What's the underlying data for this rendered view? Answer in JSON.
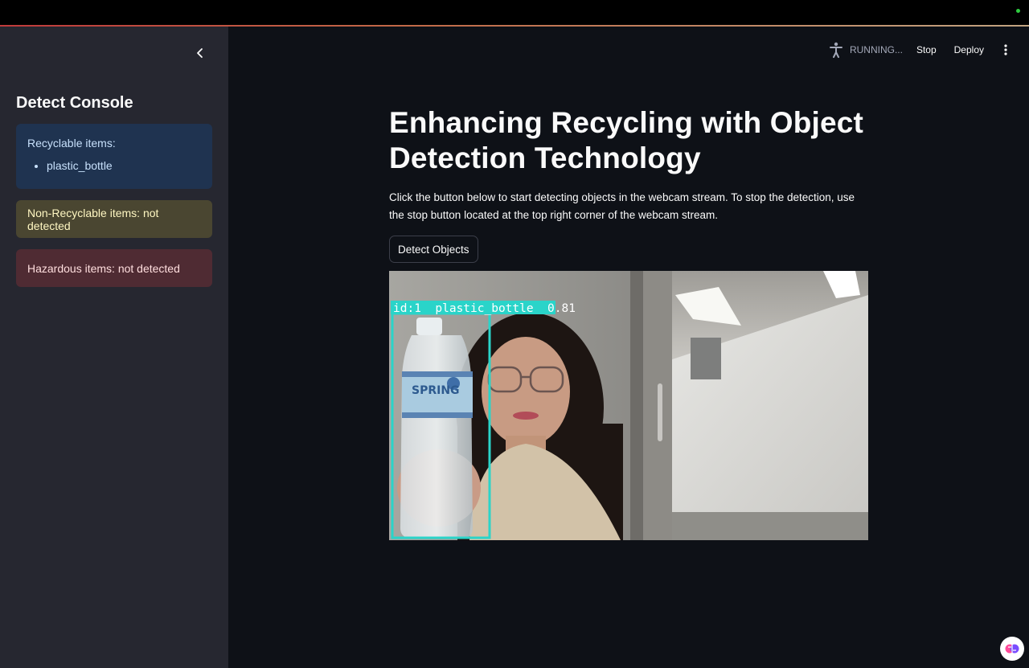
{
  "sidebar": {
    "title": "Detect Console",
    "recyclable": {
      "label": "Recyclable items:",
      "items": [
        "plastic_bottle"
      ]
    },
    "non_recyclable": "Non-Recyclable items: not detected",
    "hazardous": "Hazardous items: not detected"
  },
  "header": {
    "status": "RUNNING...",
    "stop_label": "Stop",
    "deploy_label": "Deploy"
  },
  "main": {
    "title": "Enhancing Recycling with Object Detection Technology",
    "description": "Click the button below to start detecting objects in the webcam stream. To stop the detection, use the stop button located at the top right corner of the webcam stream.",
    "detect_button": "Detect Objects"
  },
  "webcam": {
    "detection_label": "id:1  plastic_bottle  0.81",
    "bottle_text": "SPRING"
  },
  "colors": {
    "background": "#0e1117",
    "sidebar": "#262730",
    "detection_box": "#2ad4c9",
    "info_alert": "#1f3350",
    "warning_alert": "#4a4631",
    "error_alert": "#4f2b33"
  },
  "icons": [
    "chevron-left-icon",
    "running-person-icon",
    "more-vertical-icon",
    "brain-icon"
  ]
}
